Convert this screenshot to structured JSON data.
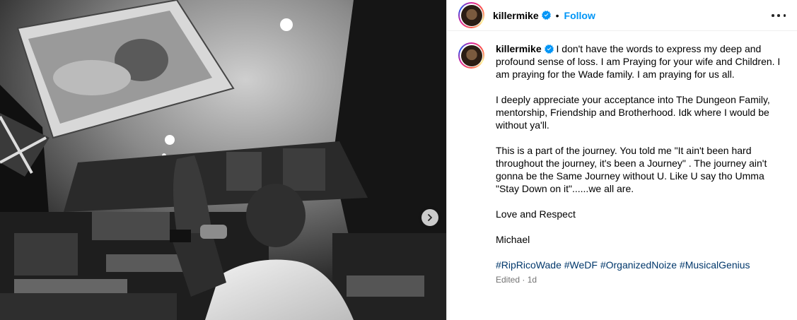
{
  "header": {
    "username": "killermike",
    "separator": "•",
    "follow_label": "Follow"
  },
  "caption": {
    "username": "killermike",
    "paragraphs": [
      "I don't have the words to express my deep and profound sense of loss. I am Praying for your wife and Children. I am praying for the Wade family. I am praying for us all.",
      "I deeply appreciate your acceptance into The Dungeon Family, mentorship, Friendship and Brotherhood. Idk where I would be without ya'll.",
      "This is a part of the journey. You told me \"It ain't been hard throughout the journey, it's been a Journey\" . The journey ain't gonna be the Same Journey without U. Like U say tho Umma \"Stay Down on it\"......we all are.",
      "Love and Respect",
      "Michael"
    ],
    "hashtags": [
      "#RipRicoWade",
      "#WeDF",
      "#OrganizedNoize",
      "#MusicalGenius"
    ],
    "meta": "Edited · 1d"
  },
  "colors": {
    "follow": "#0095f6",
    "hashtag": "#00376b",
    "verified": "#0095f6",
    "meta": "#737373"
  },
  "icons": {
    "verified": "verified-badge-icon",
    "more": "more-horizontal-icon",
    "next": "chevron-right-icon"
  }
}
